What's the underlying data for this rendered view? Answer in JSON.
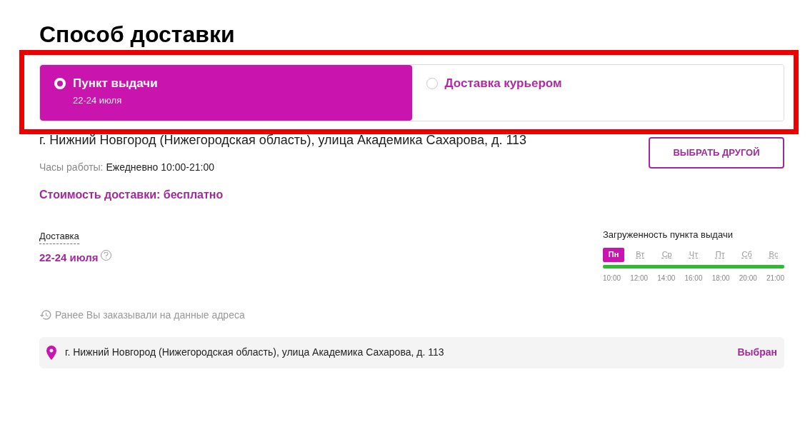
{
  "title": "Способ доставки",
  "options": [
    {
      "label": "Пункт выдачи",
      "sublabel": "22-24 июля",
      "selected": true
    },
    {
      "label": "Доставка курьером",
      "selected": false
    }
  ],
  "address": "г. Нижний Новгород (Нижегородская область), улица Академика Сахарова, д. 113",
  "change_button": "ВЫБРАТЬ ДРУГОЙ",
  "hours": {
    "label": "Часы работы:",
    "value": "Ежедневно 10:00-21:00"
  },
  "cost": "Стоимость доставки: бесплатно",
  "delivery": {
    "label": "Доставка",
    "value": "22-24 июля"
  },
  "load": {
    "title": "Загруженность пункта выдачи",
    "days": [
      {
        "label": "Пн",
        "selected": true
      },
      {
        "label": "Вт",
        "selected": false
      },
      {
        "label": "Ср",
        "selected": false
      },
      {
        "label": "Чт",
        "selected": false
      },
      {
        "label": "Пт",
        "selected": false
      },
      {
        "label": "Сб",
        "selected": false
      },
      {
        "label": "Вс",
        "selected": false
      }
    ],
    "times": [
      "10:00",
      "12:00",
      "14:00",
      "16:00",
      "18:00",
      "20:00",
      "21:00"
    ]
  },
  "history_label": "Ранее Вы заказывали на данные адреса",
  "saved_addresses": [
    {
      "address": "г. Нижний Новгород (Нижегородская область), улица Академика Сахарова, д. 113",
      "status": "Выбран"
    }
  ]
}
